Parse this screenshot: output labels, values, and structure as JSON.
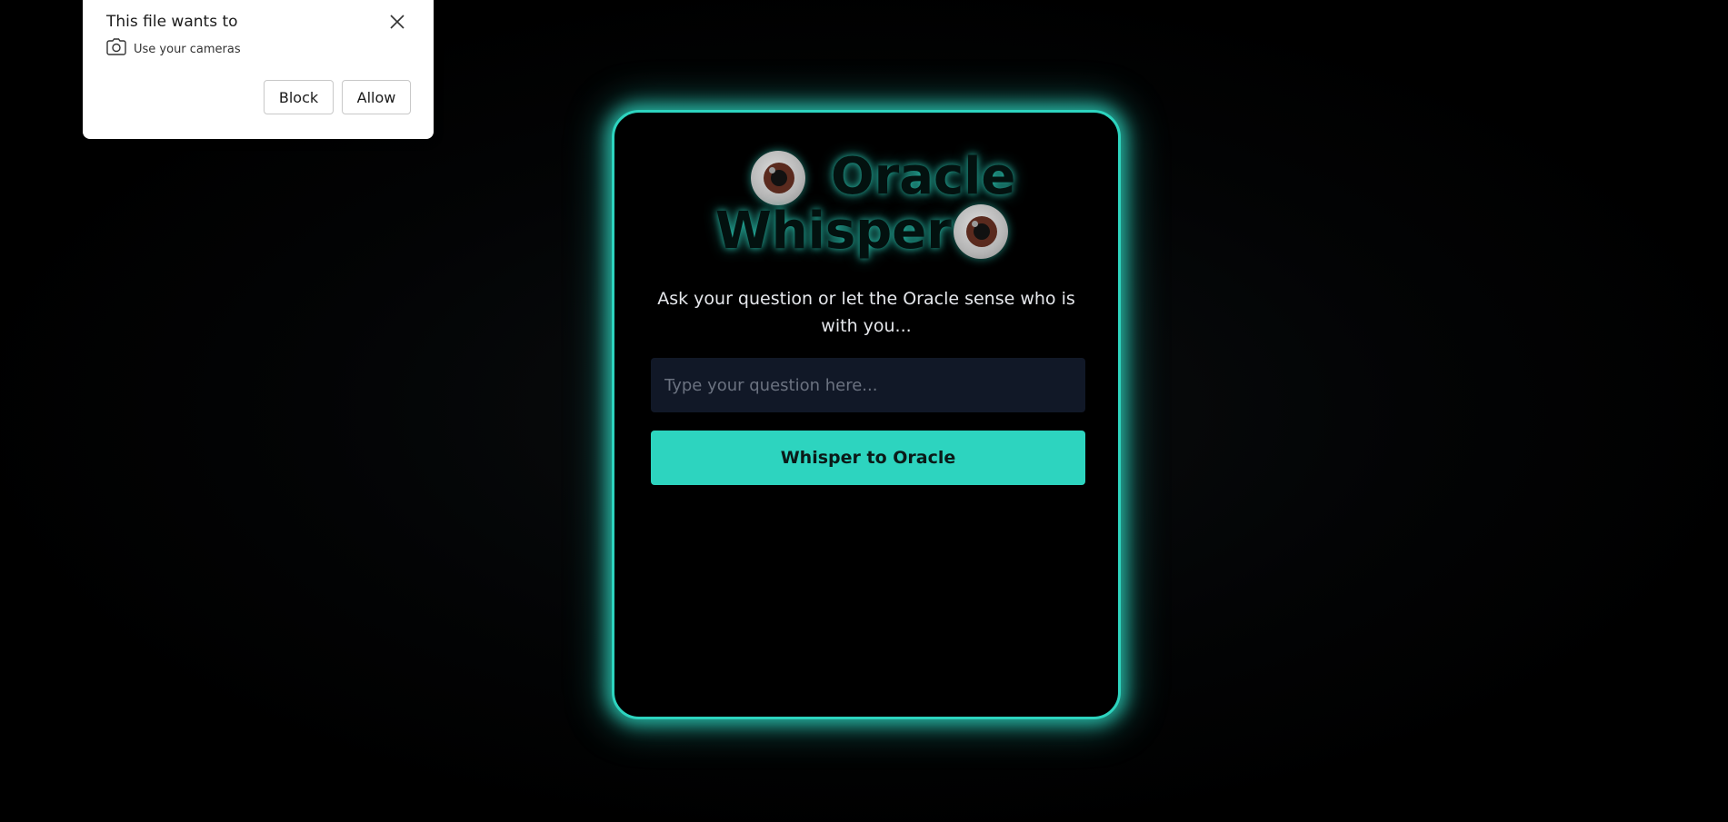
{
  "permission_popup": {
    "title": "This file wants to",
    "permission": {
      "icon": "camera-icon",
      "label": "Use your cameras"
    },
    "close_icon": "close-icon",
    "buttons": {
      "block": "Block",
      "allow": "Allow"
    }
  },
  "oracle": {
    "title_line1": "Oracle",
    "title_line2": "Whisper",
    "eye_icon": "eye-icon",
    "subtitle": "Ask your question or let the Oracle sense who is with you...",
    "input": {
      "placeholder": "Type your question here...",
      "value": ""
    },
    "submit_label": "Whisper to Oracle"
  },
  "colors": {
    "accent": "#2dd4bf",
    "background": "#000000",
    "input_bg": "#111827",
    "popup_bg": "#ffffff"
  }
}
